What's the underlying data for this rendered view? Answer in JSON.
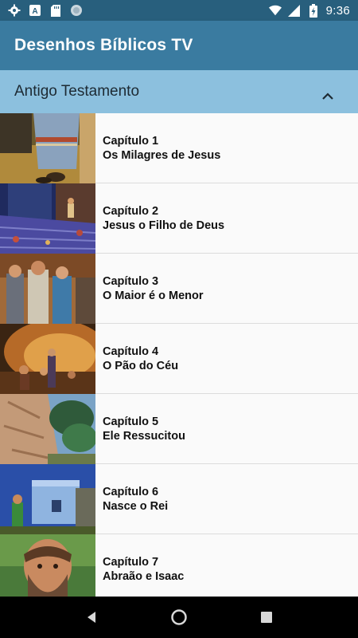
{
  "status_bar": {
    "time": "9:36",
    "left_icons": [
      "gear-icon",
      "font-a-icon",
      "sd-card-icon",
      "sync-circle-icon"
    ],
    "right_icons": [
      "wifi-icon",
      "signal-icon",
      "battery-charging-icon"
    ]
  },
  "app_bar": {
    "title": "Desenhos Bíblicos TV"
  },
  "section": {
    "title": "Antigo Testamento",
    "toggle_icon": "chevron-up-icon"
  },
  "items": [
    {
      "chapter": "Capítulo 1",
      "title": "Os Milagres de Jesus"
    },
    {
      "chapter": "Capítulo 2",
      "title": "Jesus o Filho de Deus"
    },
    {
      "chapter": "Capítulo 3",
      "title": "O Maior é o Menor"
    },
    {
      "chapter": "Capítulo 4",
      "title": "O Pão do Céu"
    },
    {
      "chapter": "Capítulo 5",
      "title": "Ele Ressucitou"
    },
    {
      "chapter": "Capítulo 6",
      "title": "Nasce o Rei"
    },
    {
      "chapter": "Capítulo 7",
      "title": "Abraão e Isaac"
    }
  ],
  "nav_bar": {
    "icons": [
      "back-icon",
      "home-icon",
      "recents-icon"
    ]
  }
}
